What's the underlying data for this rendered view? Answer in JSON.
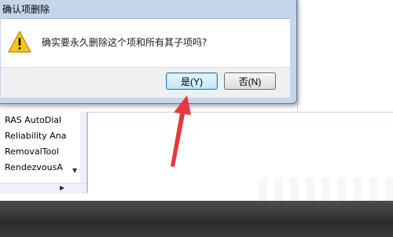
{
  "dialog": {
    "title": "确认项删除",
    "message": "确实要永久删除这个项和所有其子项吗?",
    "yes_label": "是(Y)",
    "no_label": "否(N)"
  },
  "tree": {
    "items": [
      {
        "label": "RAS AutoDial"
      },
      {
        "label": "Reliability Ana"
      },
      {
        "label": "RemovalTool"
      },
      {
        "label": "RendezvousA"
      }
    ]
  },
  "colors": {
    "arrow": "#e8383d",
    "warning": "#f7c51e"
  }
}
